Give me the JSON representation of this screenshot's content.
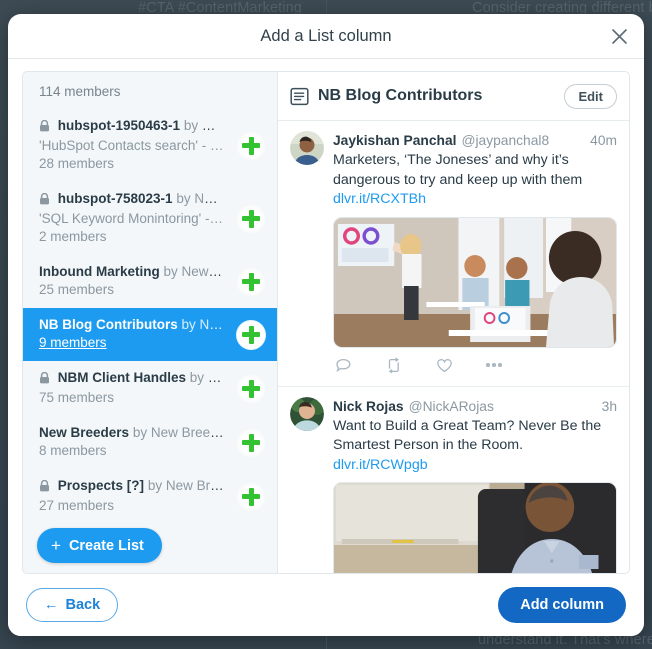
{
  "background": {
    "text_top_left": "#CTA #ContentMarketing",
    "text_top_right": "Consider creating different banners",
    "text_bottom": "understand it. That's where the"
  },
  "modal": {
    "title": "Add a List column",
    "close_icon": "close-icon"
  },
  "lists_panel": {
    "members_total": "114 members",
    "create_button": "Create List",
    "create_plus": "+",
    "items": [
      {
        "name": "hubspot-1950463-1",
        "owner": "by Ne…",
        "description": "'HubSpot Contacts search' - auto-…",
        "members": "28 members",
        "private": true,
        "selected": false
      },
      {
        "name": "hubspot-758023-1",
        "owner": "by New …",
        "description": "'SQL Keyword Monintoring' - auto-…",
        "members": "2 members",
        "private": true,
        "selected": false
      },
      {
        "name": "Inbound Marketing",
        "owner": "by New Bre…",
        "description": "",
        "members": "25 members",
        "private": false,
        "selected": false
      },
      {
        "name": "NB Blog Contributors",
        "owner": "by New B…",
        "description": "",
        "members": "9 members",
        "private": false,
        "selected": true
      },
      {
        "name": "NBM Client Handles",
        "owner": "by New…",
        "description": "",
        "members": "75 members",
        "private": true,
        "selected": false
      },
      {
        "name": "New Breeders",
        "owner": "by New Breed M…",
        "description": "",
        "members": "8 members",
        "private": false,
        "selected": false
      },
      {
        "name": "Prospects [?]",
        "owner": "by New Breed …",
        "description": "",
        "members": "27 members",
        "private": true,
        "selected": false
      }
    ]
  },
  "preview_panel": {
    "list_icon": "list-icon",
    "title": "NB Blog Contributors",
    "edit_label": "Edit",
    "tweets": [
      {
        "author": "Jaykishan Panchal",
        "handle": "@jaypanchal8",
        "time": "40m",
        "text": "Marketers, ‘The Joneses’ and why it’s dangerous to try and keep up with them",
        "link": "dlvr.it/RCXTBh",
        "has_media": true,
        "actions": [
          "reply-icon",
          "retweet-icon",
          "like-icon",
          "more-icon"
        ]
      },
      {
        "author": "Nick Rojas",
        "handle": "@NickARojas",
        "time": "3h",
        "text": "Want to Build a Great Team? Never Be the Smartest Person in the Room.",
        "link": "dlvr.it/RCWpgb",
        "has_media": true,
        "actions": []
      }
    ]
  },
  "footer": {
    "back_label": "Back",
    "back_arrow": "←",
    "add_column_label": "Add column"
  },
  "colors": {
    "accent_blue": "#1d9bf0",
    "primary_blue": "#1268c3",
    "green_plus": "#32c232",
    "link_blue": "#1d9bf0",
    "panel_bg": "#f4f7f9"
  }
}
